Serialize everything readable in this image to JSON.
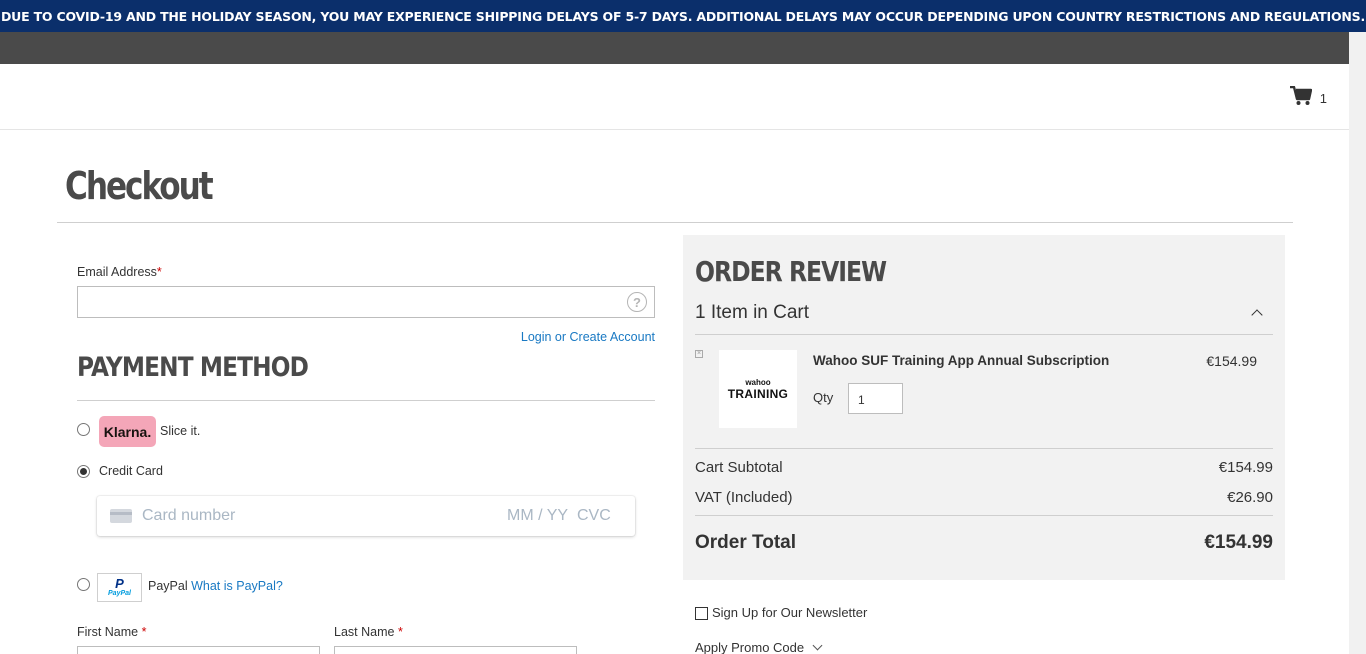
{
  "banner": {
    "text": "DUE TO COVID-19 AND THE HOLIDAY SEASON, YOU MAY EXPERIENCE SHIPPING DELAYS OF 5-7 DAYS. ADDITIONAL DELAYS MAY OCCUR DEPENDING UPON COUNTRY RESTRICTIONS AND REGULATIONS."
  },
  "header": {
    "cart_count": "1",
    "cart_icon": "cart-icon"
  },
  "page": {
    "title": "Checkout"
  },
  "email": {
    "label": "Email Address",
    "required_mark": "*",
    "value": "",
    "help_icon": "help-icon",
    "help_glyph": "?"
  },
  "login_link": "Login or Create Account",
  "payment": {
    "title": "PAYMENT METHOD",
    "klarna": {
      "badge": "Klarna.",
      "label": "Slice it.",
      "selected": false
    },
    "credit_card": {
      "label": "Credit Card",
      "selected": true,
      "card_number_placeholder": "Card number",
      "expiry_placeholder": "MM / YY",
      "cvc_placeholder": "CVC"
    },
    "paypal": {
      "label": "PayPal",
      "link": "What is PayPal?",
      "logo_text": "P",
      "logo_word": "PayPal",
      "selected": false
    }
  },
  "name_fields": {
    "first": {
      "label": "First Name",
      "required_mark": "*"
    },
    "last": {
      "label": "Last Name",
      "required_mark": "*"
    }
  },
  "order_review": {
    "title": "ORDER REVIEW",
    "items_count": "1 Item in Cart",
    "item": {
      "name": "Wahoo SUF Training App Annual Subscription",
      "price": "€154.99",
      "qty_label": "Qty",
      "qty": "1",
      "thumb_line1": "wahoo",
      "thumb_line2": "TRAINING",
      "remove_glyph": "×"
    },
    "subtotal": {
      "label": "Cart Subtotal",
      "value": "€154.99"
    },
    "vat": {
      "label": "VAT (Included)",
      "value": "€26.90"
    },
    "total": {
      "label": "Order Total",
      "value": "€154.99"
    }
  },
  "newsletter": {
    "label": "Sign Up for Our Newsletter",
    "checked": false
  },
  "promo": {
    "label": "Apply Promo Code"
  },
  "colors": {
    "banner_bg": "#0b2f6b",
    "link": "#1979c3",
    "klarna_pink": "#f4a6b8",
    "review_bg": "#f2f2f2",
    "required": "#cc0000"
  }
}
